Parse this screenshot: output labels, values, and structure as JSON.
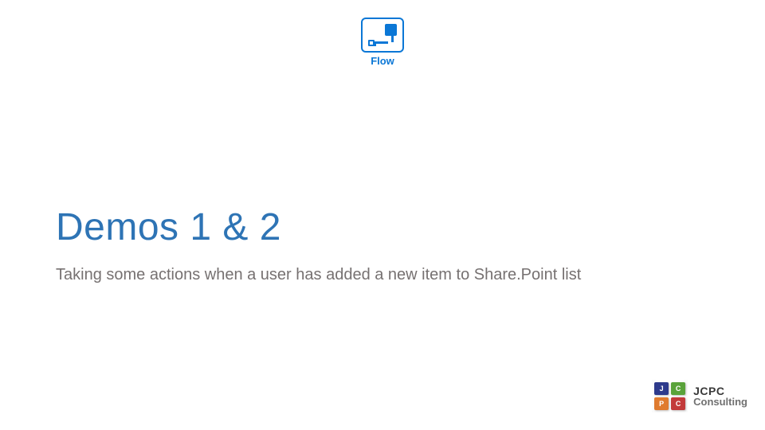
{
  "flow": {
    "label": "Flow"
  },
  "slide": {
    "title": "Demos 1 & 2",
    "subtitle": "Taking some actions when a user has added a new item to Share.Point list"
  },
  "footer": {
    "company_abbr": "JCPC",
    "company_word": "Consulting",
    "tiles": {
      "j": "J",
      "c1": "C",
      "p": "P",
      "c2": "C"
    }
  }
}
